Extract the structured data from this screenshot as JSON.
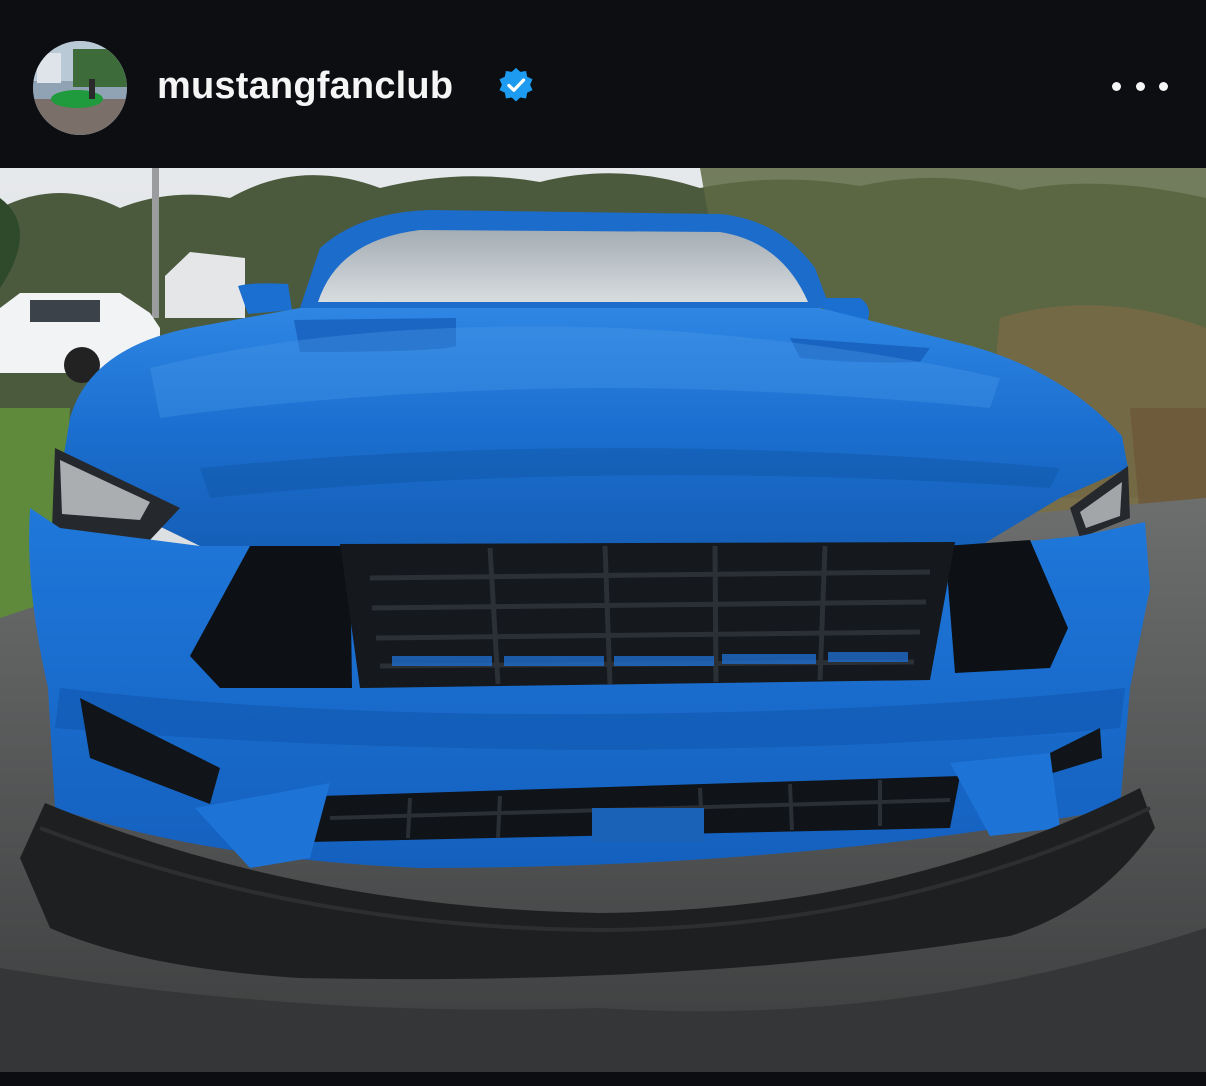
{
  "post": {
    "username": "mustangfanclub",
    "verified": true,
    "avatar_icon": "profile-avatar",
    "more_icon": "more-options-icon"
  },
  "colors": {
    "header_bg": "#0c0e12",
    "verified_badge": "#1d9bf0",
    "car_paint": "#1a6fd1"
  }
}
